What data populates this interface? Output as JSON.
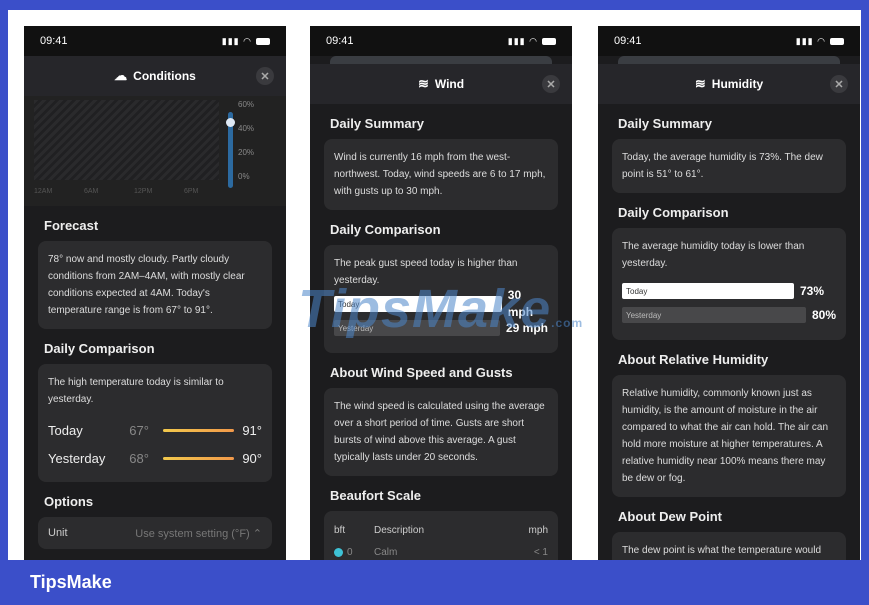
{
  "status_time": "09:41",
  "conditions": {
    "title": "Conditions",
    "chart_y_ticks": [
      "60%",
      "40%",
      "20%",
      "0%"
    ],
    "chart_x_ticks": [
      "12AM",
      "6AM",
      "12PM",
      "6PM"
    ],
    "chart_badge": "60%",
    "forecast_title": "Forecast",
    "forecast_text": "78° now and mostly cloudy. Partly cloudy conditions from 2AM–4AM, with mostly clear conditions expected at 4AM. Today's temperature range is from 67° to 91°.",
    "comparison_title": "Daily Comparison",
    "comparison_text": "The high temperature today is similar to yesterday.",
    "rows": [
      {
        "label": "Today",
        "low": "67°",
        "high": "91°"
      },
      {
        "label": "Yesterday",
        "low": "68°",
        "high": "90°"
      }
    ],
    "options_title": "Options",
    "unit_label": "Unit",
    "unit_value": "Use system setting (°F)"
  },
  "wind": {
    "title": "Wind",
    "summary_title": "Daily Summary",
    "summary_text": "Wind is currently 16 mph from the west-northwest. Today, wind speeds are 6 to 17 mph, with gusts up to 30 mph.",
    "comparison_title": "Daily Comparison",
    "comparison_text": "The peak gust speed today is higher than yesterday.",
    "bars": [
      {
        "label": "Today",
        "value": "30 mph",
        "fraction": 1.0
      },
      {
        "label": "Yesterday",
        "value": "29 mph",
        "fraction": 0.95
      }
    ],
    "about_title": "About Wind Speed and Gusts",
    "about_text": "The wind speed is calculated using the average over a short period of time. Gusts are short bursts of wind above this average. A gust typically lasts under 20 seconds.",
    "beaufort_title": "Beaufort Scale",
    "beaufort_headers": [
      "bft",
      "Description",
      "mph"
    ],
    "beaufort_first": {
      "bft": "0",
      "desc": "Calm",
      "mph": "< 1"
    }
  },
  "humidity": {
    "title": "Humidity",
    "summary_title": "Daily Summary",
    "summary_text": "Today, the average humidity is 73%. The dew point is 51° to 61°.",
    "comparison_title": "Daily Comparison",
    "comparison_text": "The average humidity today is lower than yesterday.",
    "bars": [
      {
        "label": "Today",
        "value": "73%",
        "fraction": 0.91
      },
      {
        "label": "Yesterday",
        "value": "80%",
        "fraction": 1.0
      }
    ],
    "about_title": "About Relative Humidity",
    "about_text": "Relative humidity, commonly known just as humidity, is the amount of moisture in the air compared to what the air can hold. The air can hold more moisture at higher temperatures. A relative humidity near 100% means there may be dew or fog.",
    "dew_title": "About Dew Point",
    "dew_text": "The dew point is what the temperature would"
  },
  "watermark": "TipsMake",
  "watermark_suffix": ".com",
  "footer": "TipsMake"
}
